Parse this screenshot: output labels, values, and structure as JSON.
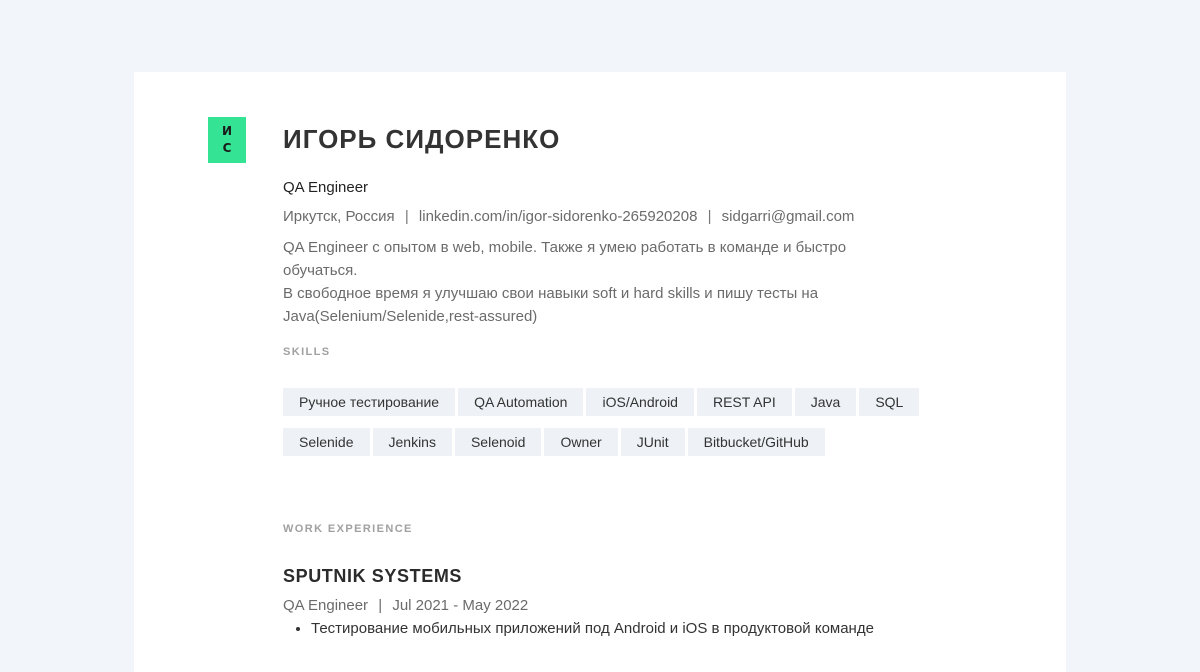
{
  "resume": {
    "initials": [
      "И",
      "С"
    ],
    "name": "ИГОРЬ СИДОРЕНКО",
    "title": "QA Engineer",
    "contacts": {
      "location": "Иркутск, Россия",
      "linkedin": "linkedin.com/in/igor-sidorenko-265920208",
      "email": "sidgarri@gmail.com",
      "separator": "|"
    },
    "summary": [
      "QA Engineer с опытом в web, mobile. Также я умею работать в команде и быстро обучаться.",
      "В свободное время я улучшаю свои навыки soft и hard skills и пишу тесты на",
      "Java(Selenium/Selenide,rest-assured)"
    ],
    "skills_label": "SKILLS",
    "skills": [
      "Ручное тестирование",
      "QA Automation",
      "iOS/Android",
      "REST API",
      "Java",
      "SQL",
      "Selenide",
      "Jenkins",
      "Selenoid",
      "Owner",
      "JUnit",
      "Bitbucket/GitHub"
    ],
    "experience_label": "WORK EXPERIENCE",
    "experience": [
      {
        "company": "SPUTNIK SYSTEMS",
        "role": "QA Engineer",
        "period": "Jul 2021 - May 2022",
        "bullets": [
          "Тестирование мобильных приложений под Android и iOS в продуктовой команде"
        ]
      }
    ]
  },
  "colors": {
    "background": "#f2f6fa",
    "badge": "#34e394",
    "chip": "#eef2f6"
  }
}
